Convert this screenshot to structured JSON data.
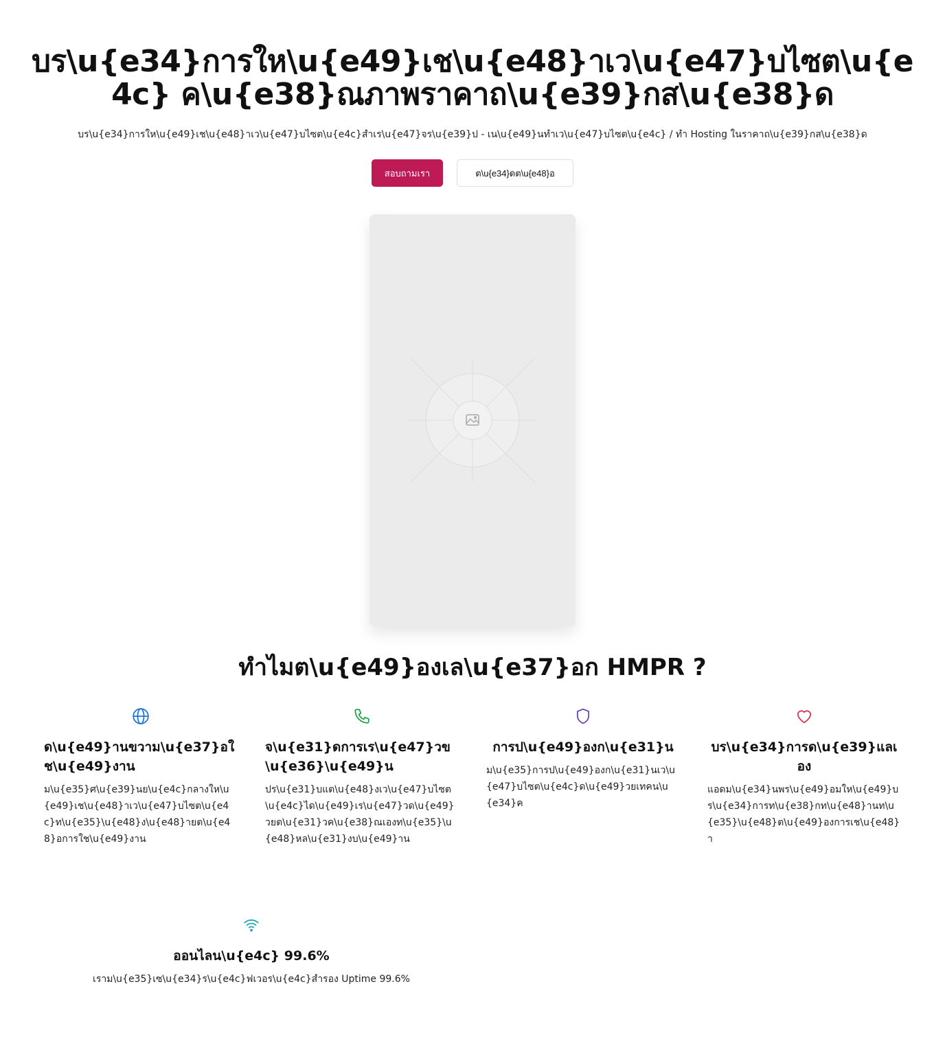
{
  "hero": {
    "title": "บร\\u{e34}การให\\u{e49}เช\\u{e48}าเว\\u{e47}บไซต\\u{e4c} ค\\u{e38}ณภาพราคาถ\\u{e39}กส\\u{e38}ด",
    "subtitle": "บร\\u{e34}การให\\u{e49}เช\\u{e48}าเว\\u{e47}บไซต\\u{e4c}สำเร\\u{e47}จร\\u{e39}ป - เน\\u{e49}นทำเว\\u{e47}บไซต\\u{e4c} / ทำ Hosting ในราคาถ\\u{e39}กส\\u{e38}ด",
    "primary_button": "สอบถามเรา",
    "secondary_button": "ต\\u{e34}ดต\\u{e48}อ"
  },
  "placeholder_image": {
    "icon": "image-icon"
  },
  "why": {
    "title": "ทำไมต\\u{e49}องเล\\u{e37}อก HMPR ?"
  },
  "features": [
    {
      "icon": "globe-icon",
      "color": "#1a73d8",
      "title": "ด\\u{e49}านขวาม\\u{e37}อใช\\u{e49}งาน",
      "text": "ม\\u{e35}ศ\\u{e39}นย\\u{e4c}กลางให\\u{e49}เช\\u{e48}าเว\\u{e47}บไซต\\u{e4c}ท\\u{e35}\\u{e48}ง\\u{e48}ายต\\u{e48}อการใช\\u{e49}งาน"
    },
    {
      "icon": "phone-icon",
      "color": "#1f9e4a",
      "title": "จ\\u{e31}ดการเร\\u{e47}วข\\u{e36}\\u{e49}น",
      "text": "ปร\\u{e31}บแต\\u{e48}งเว\\u{e47}บไซต\\u{e4c}ได\\u{e49}เร\\u{e47}วด\\u{e49}วยต\\u{e31}วค\\u{e38}ณเองท\\u{e35}\\u{e48}หล\\u{e31}งบ\\u{e49}าน"
    },
    {
      "icon": "shield-icon",
      "color": "#6b3fb5",
      "title": "การป\\u{e49}องก\\u{e31}น",
      "text": "ม\\u{e35}การป\\u{e49}องก\\u{e31}นเว\\u{e47}บไซต\\u{e4c}ด\\u{e49}วยเทคน\\u{e34}ค"
    },
    {
      "icon": "heart-icon",
      "color": "#d6304a",
      "title": "บร\\u{e34}การด\\u{e39}แลเอง",
      "text": "แอดม\\u{e34}นพร\\u{e49}อมให\\u{e49}บร\\u{e34}การท\\u{e38}กท\\u{e48}านท\\u{e35}\\u{e48}ต\\u{e49}องการเช\\u{e48}า"
    },
    {
      "icon": "wifi-icon",
      "color": "#1aa3b8",
      "title": "ออนไลน\\u{e4c} 99.6%",
      "text": "เราม\\u{e35}เซ\\u{e34}ร\\u{e4c}ฟเวอร\\u{e4c}สำรอง Uptime 99.6%"
    }
  ]
}
